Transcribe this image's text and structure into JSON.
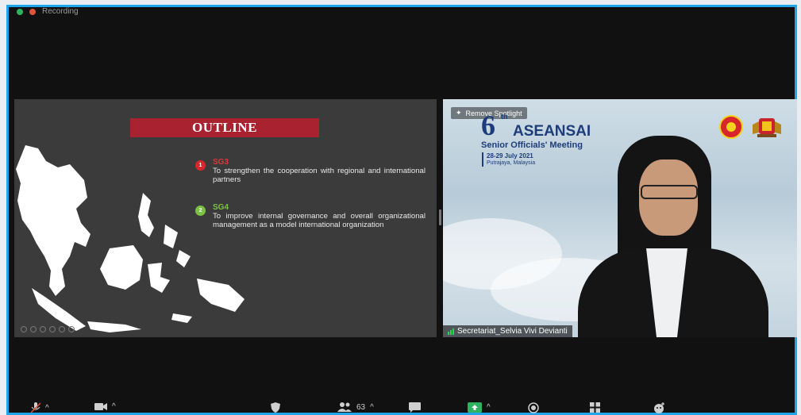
{
  "recording": {
    "label": "Recording"
  },
  "share": {
    "title": "OUTLINE",
    "goals": [
      {
        "num": "1",
        "code": "SG3",
        "text": "To strengthen the cooperation with regional and international partners"
      },
      {
        "num": "2",
        "code": "SG4",
        "text": "To improve internal governance and overall organizational management as a model international organization"
      }
    ]
  },
  "video": {
    "spotlight_label": "Remove Spotlight",
    "event_num": "6",
    "event_num_suffix": "th",
    "event_name": "ASEANSAI",
    "event_sub": "Senior Officials' Meeting",
    "event_dates": "28-29 July 2021",
    "event_place": "Putrajaya, Malaysia",
    "participant": "Secretariat_Selvia Vivi Devianti"
  },
  "toolbar": {
    "participants_count": "63"
  },
  "colors": {
    "accent": "#1fa6ea",
    "title_bar": "#a8232f",
    "sg3": "#e2343a",
    "sg4": "#7cc144"
  }
}
